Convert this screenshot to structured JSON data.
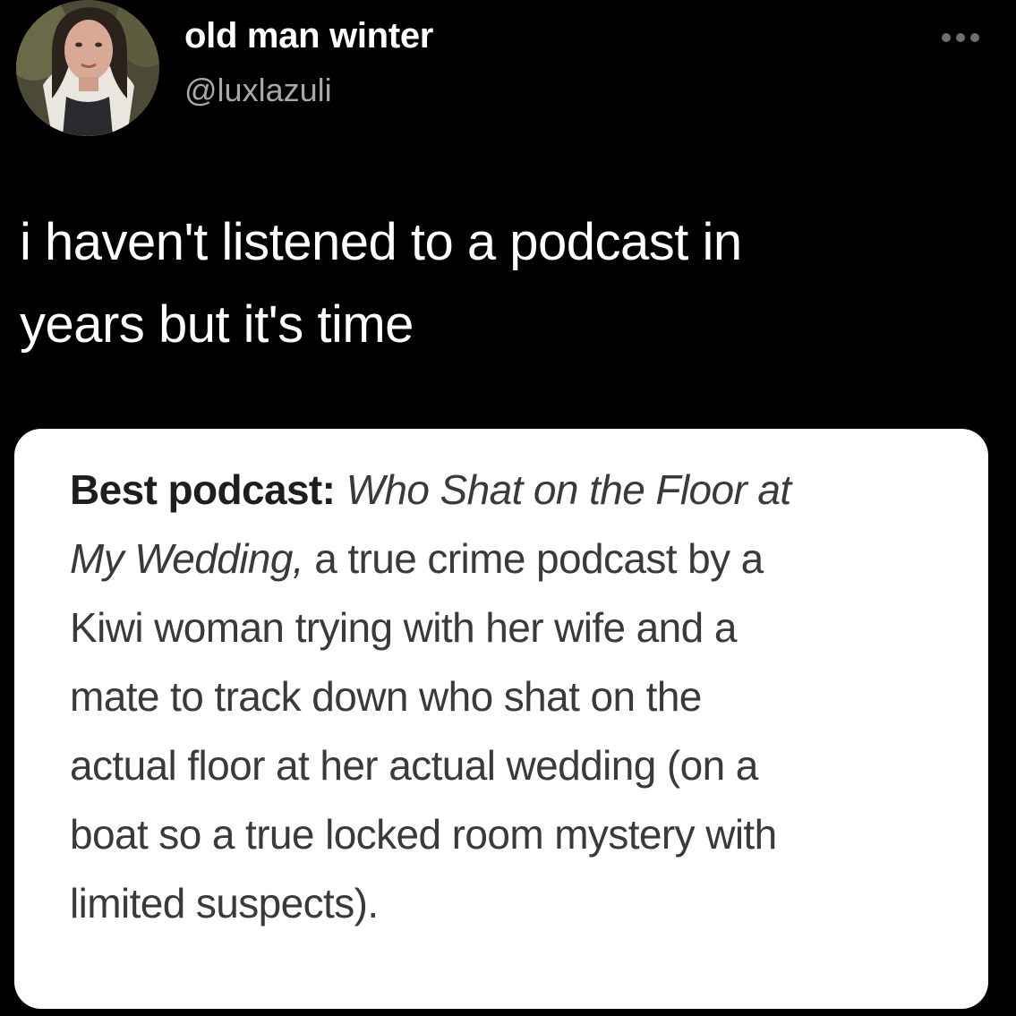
{
  "tweet": {
    "author": {
      "display_name": "old man winter",
      "handle": "@luxlazuli"
    },
    "text_lines": [
      "i haven't listened to a podcast in",
      "years but it's time"
    ],
    "menu_icon": "more-horizontal-icon"
  },
  "media": {
    "lines": [
      {
        "bold": "Best podcast:",
        "italic": "Who Shat on the Floor at",
        "rest": ""
      },
      {
        "bold": "",
        "italic": "My Wedding,",
        "rest": "a true crime podcast by a"
      },
      {
        "bold": "",
        "italic": "",
        "rest": "Kiwi woman trying with her wife and a"
      },
      {
        "bold": "",
        "italic": "",
        "rest": "mate to track down who shat on the"
      },
      {
        "bold": "",
        "italic": "",
        "rest": "actual floor at her actual wedding (on a"
      },
      {
        "bold": "",
        "italic": "",
        "rest": "boat so a true locked room mystery with"
      },
      {
        "bold": "",
        "italic": "",
        "rest": "limited suspects)."
      }
    ]
  },
  "colors": {
    "background": "#000000",
    "primary_text": "#ffffff",
    "secondary_text": "#a8a8a8",
    "card_background": "#ffffff",
    "card_text": "#3a3a3a"
  }
}
